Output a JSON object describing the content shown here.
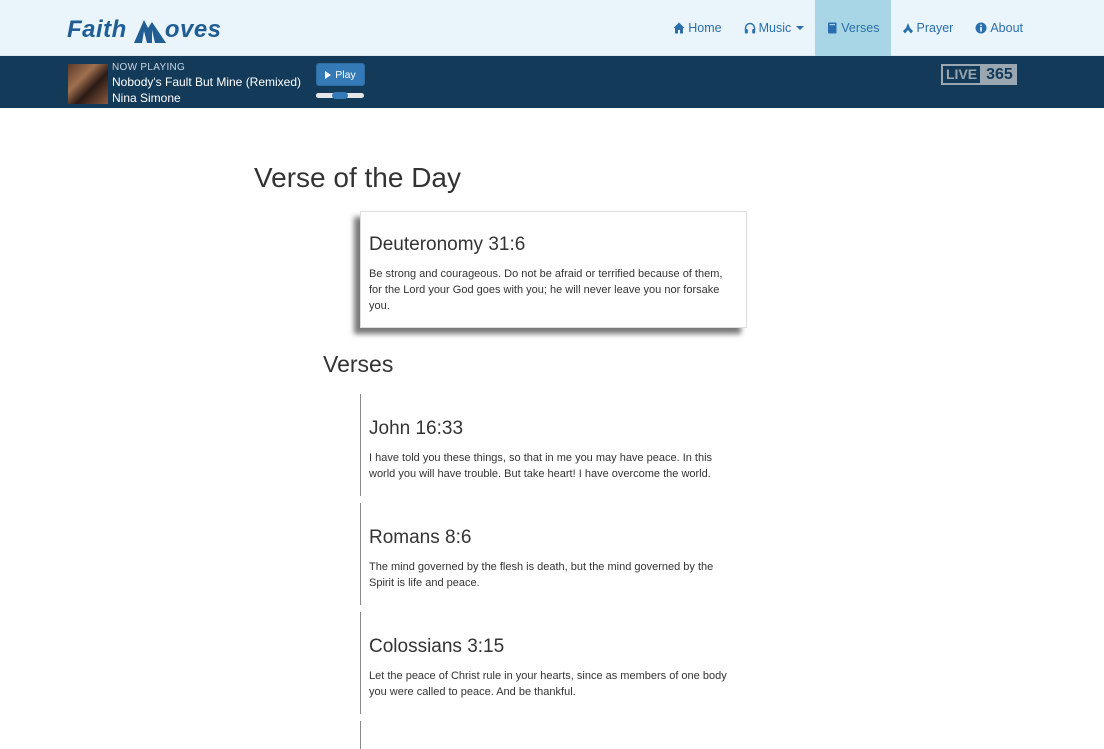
{
  "nav": {
    "logo_text_1": "Faith",
    "logo_text_2": "oves",
    "items": [
      {
        "label": "Home",
        "icon": "home-icon"
      },
      {
        "label": "Music",
        "icon": "headphones-icon"
      },
      {
        "label": "Verses",
        "icon": "book-icon"
      },
      {
        "label": "Prayer",
        "icon": "praying-hands-icon"
      },
      {
        "label": "About",
        "icon": "info-circle-icon"
      }
    ],
    "active": "Verses"
  },
  "player": {
    "label": "NOW PLAYING",
    "title": "Nobody's Fault But Mine (Remixed)",
    "artist": "Nina Simone",
    "play_label": "Play",
    "volume": 0.5,
    "brand_1": "LIVE",
    "brand_2": "365"
  },
  "verse_of_day": {
    "heading": "Verse of the Day",
    "reference": "Deuteronomy 31:6",
    "text": "Be strong and courageous. Do not be afraid or terrified because of them, for the Lord your God goes with you; he will never leave you nor forsake you."
  },
  "verses": {
    "heading": "Verses",
    "items": [
      {
        "reference": "John 16:33",
        "text": "I have told you these things, so that in me you may have peace. In this world you will have trouble. But take heart! I have overcome the world."
      },
      {
        "reference": "Romans 8:6",
        "text": "The mind governed by the flesh is death, but the mind governed by the Spirit is life and peace."
      },
      {
        "reference": "Colossians 3:15",
        "text": "Let the peace of Christ rule in your hearts, since as members of one body you were called to peace. And be thankful."
      }
    ]
  },
  "colors": {
    "navbar_bg": "#eaf4fb",
    "player_bg": "#133a59",
    "accent": "#337ab7",
    "active_tab": "#a9d6e6"
  }
}
